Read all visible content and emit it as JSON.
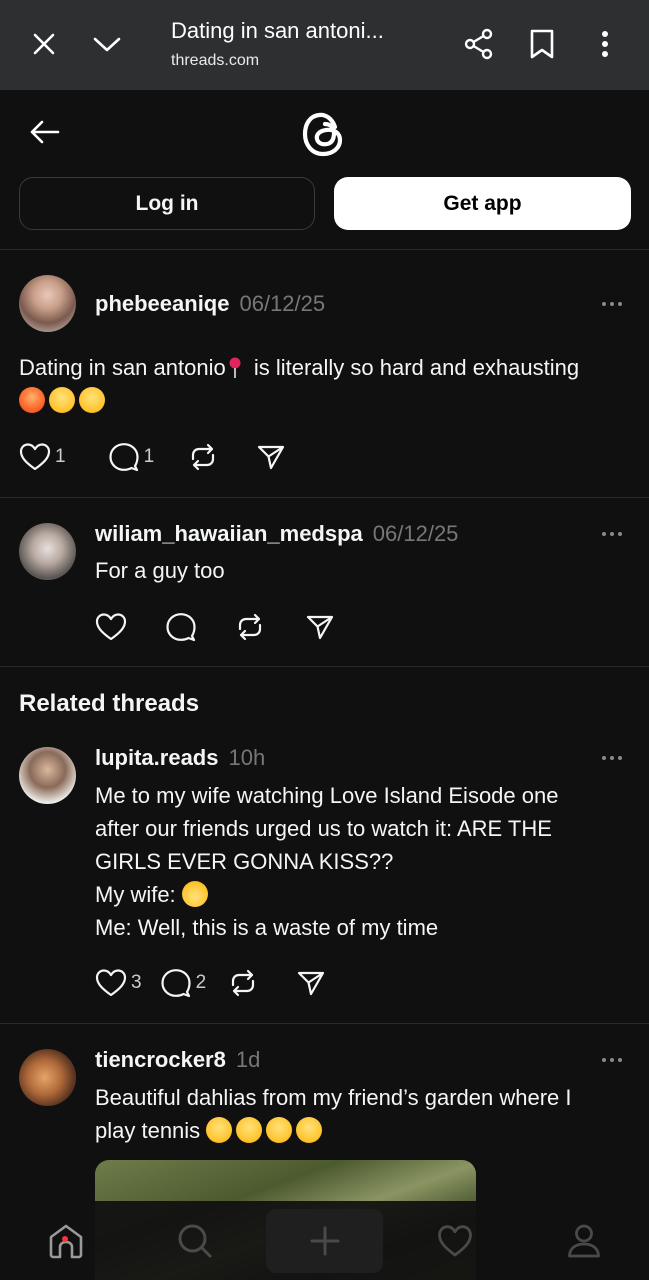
{
  "browser": {
    "title": "Dating in san antoni...",
    "url": "threads.com"
  },
  "header": {
    "login_label": "Log in",
    "getapp_label": "Get app"
  },
  "main_post": {
    "username": "phebeeaniqe",
    "time": "06/12/25",
    "text_part1": "Dating in san antonio",
    "text_part2": " is literally so hard and exhausting",
    "likes": "1",
    "replies": "1"
  },
  "reply_post": {
    "username": "wiliam_hawaiian_medspa",
    "time": "06/12/25",
    "text": "For a guy too"
  },
  "related": {
    "title": "Related threads",
    "posts": [
      {
        "username": "lupita.reads",
        "time": "10h",
        "lines": [
          "Me to my wife watching Love Island Eisode one",
          "after our friends urged us to watch it: ARE THE",
          "GIRLS EVER GONNA KISS??",
          "My wife: ",
          "Me: Well, this is a waste of my time"
        ],
        "likes": "3",
        "replies": "2"
      },
      {
        "username": "tiencrocker8",
        "time": "1d",
        "lines": [
          "Beautiful dahlias from my friend’s garden where I",
          "play tennis "
        ]
      }
    ]
  },
  "colors": {
    "background": "#101010",
    "chrome": "#2e2f31",
    "muted_text": "#777777",
    "notification_dot": "#ff3040"
  },
  "icons": {
    "close": "close-icon",
    "collapse": "chevron-down-icon",
    "share": "share-icon",
    "bookmark": "bookmark-icon",
    "menu": "kebab-icon",
    "back": "arrow-left-icon",
    "logo": "threads-logo-icon",
    "like": "heart-icon",
    "reply": "comment-icon",
    "repost": "repost-icon",
    "send": "send-icon",
    "home": "home-icon",
    "search": "search-icon",
    "create": "plus-icon",
    "activity": "heart-icon",
    "profile": "profile-icon"
  }
}
